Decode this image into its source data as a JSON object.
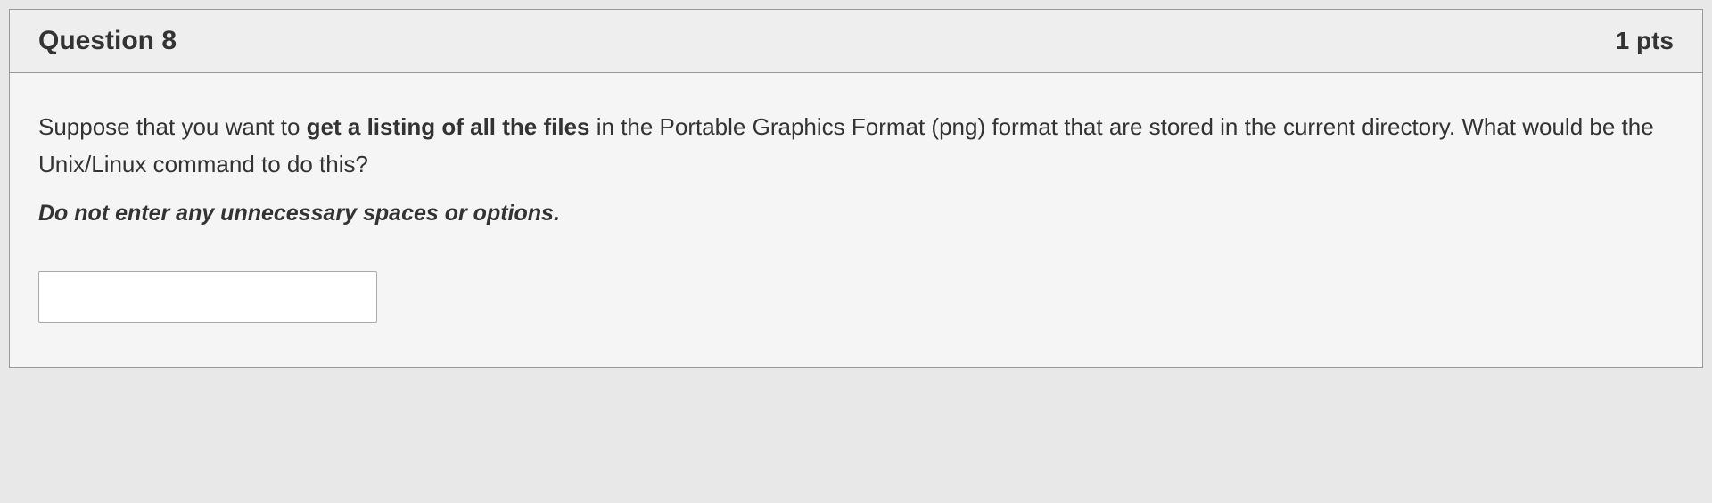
{
  "question": {
    "title": "Question 8",
    "points": "1 pts",
    "text_before_bold": "Suppose that you want to ",
    "text_bold": "get a listing of all the files",
    "text_after_bold": " in the Portable Graphics Format (png) format that are stored in the current directory. What would be the Unix/Linux command to do this?",
    "instruction": "Do not enter any unnecessary spaces or options.",
    "answer_value": ""
  }
}
